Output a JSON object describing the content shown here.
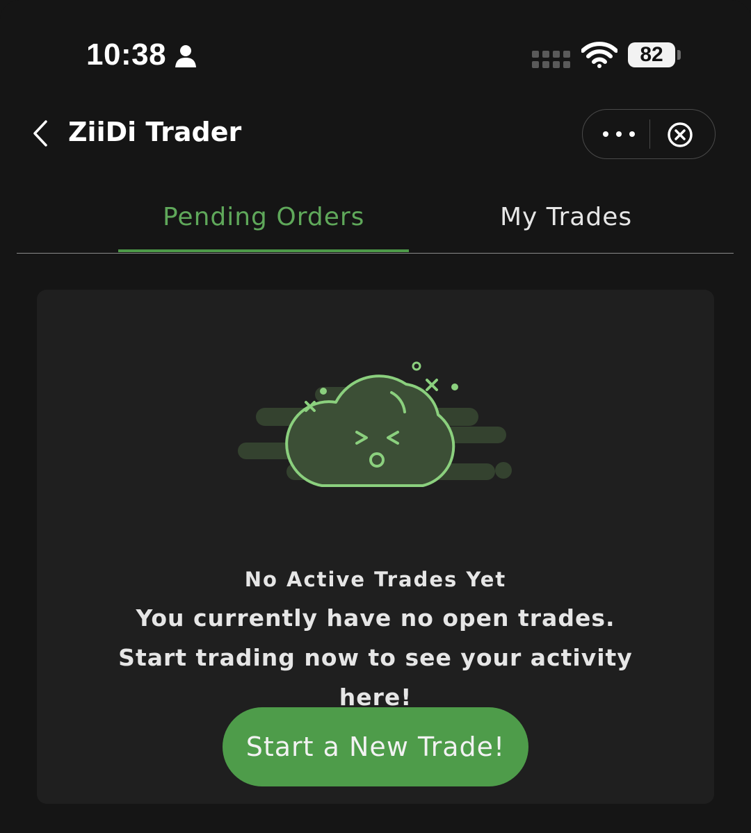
{
  "status_bar": {
    "time": "10:38",
    "battery_level": "82",
    "icons": [
      "person-icon",
      "cellular-signal-icon",
      "wifi-icon",
      "battery-icon"
    ]
  },
  "nav": {
    "title": "ZiiDi Trader",
    "icons": [
      "chevron-left-icon",
      "more-dots-icon",
      "close-circle-icon"
    ]
  },
  "tabs": [
    {
      "label": "Pending Orders",
      "active": true
    },
    {
      "label": "My Trades",
      "active": false
    }
  ],
  "empty_state": {
    "icon": "sad-cloud-illustration",
    "title": "No Active Trades Yet",
    "message": "You currently have no open trades. Start trading now to see your activity here!",
    "button_label": "Start a New Trade!"
  },
  "colors": {
    "background": "#151515",
    "card": "#1f1f1f",
    "accent": "#5fa85a",
    "button": "#4e9c4a",
    "text": "#e6e6e6"
  }
}
